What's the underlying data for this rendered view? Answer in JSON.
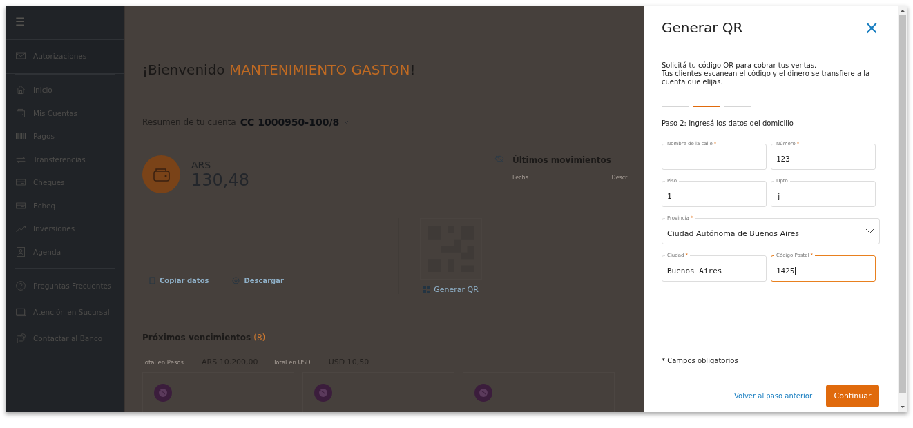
{
  "sidebar": {
    "menu_icon": "☰",
    "groups": [
      {
        "items": [
          {
            "label": "Autorizaciones"
          }
        ]
      },
      {
        "items": [
          {
            "label": "Inicio"
          },
          {
            "label": "Mis Cuentas"
          },
          {
            "label": "Pagos"
          },
          {
            "label": "Transferencias"
          },
          {
            "label": "Cheques"
          },
          {
            "label": "Echeq"
          },
          {
            "label": "Inversiones"
          },
          {
            "label": "Agenda"
          }
        ]
      },
      {
        "items": [
          {
            "label": "Preguntas Frecuentes"
          },
          {
            "label": "Atención en Sucursal"
          },
          {
            "label": "Contactar al Banco"
          }
        ]
      }
    ]
  },
  "main": {
    "greeting_prefix": "¡Bienvenido",
    "user_name": "MANTENIMIENTO GASTON",
    "greeting_suffix": "!",
    "account": {
      "label": "Resumen de tu cuenta",
      "number": "CC 1000950-100/8"
    },
    "balance": {
      "currency": "ARS",
      "amount": "130,48"
    },
    "actions": [
      {
        "label": "Copiar datos"
      },
      {
        "label": "Descargar"
      }
    ],
    "qr_link": "Generar QR",
    "movements": {
      "title": "Últimos movimientos",
      "columns": [
        "Fecha",
        "Descri"
      ]
    },
    "due": {
      "title": "Próximos vencimientos",
      "count": "(8)",
      "totals": [
        {
          "label": "Total en Pesos",
          "value": "ARS 10.200,00"
        },
        {
          "label": "Total en USD",
          "value": "USD 10,50"
        }
      ]
    }
  },
  "modal": {
    "title": "Generar QR",
    "close": "×",
    "description": [
      "Solicitá tu código QR para cobrar tus ventas.",
      "Tus clientes escanean el código y el dinero se transfiere a la cuenta que elijas."
    ],
    "steps": [
      {
        "selected": false
      },
      {
        "selected": true
      },
      {
        "selected": false
      }
    ],
    "step_label": "Paso 2: Ingresá los datos del domicilio",
    "fields": [
      {
        "kind": "text",
        "label": "Nombre de la calle",
        "required_mark": "*",
        "focused": false
      },
      {
        "kind": "text",
        "label": "Número",
        "required_mark": "*",
        "value": "123",
        "focused": false
      },
      {
        "kind": "text",
        "label": "Piso",
        "value": "1",
        "focused": false
      },
      {
        "kind": "text",
        "label": "Dpto",
        "value": "j",
        "focused": false
      },
      {
        "kind": "select",
        "label": "Provincia",
        "required_mark": "*",
        "value": "Ciudad Autónoma de Buenos Aires",
        "focused": false
      },
      {
        "kind": "text",
        "label": "Ciudad",
        "required_mark": "*",
        "value": "Buenos Aires",
        "focused": false
      },
      {
        "kind": "text",
        "label": "Código Postal",
        "required_mark": "*",
        "value": "1425",
        "focused": true
      }
    ],
    "required_note": "* Campos obligatorios",
    "back_link": "Volver al paso anterior",
    "continue_button": "Continuar"
  }
}
